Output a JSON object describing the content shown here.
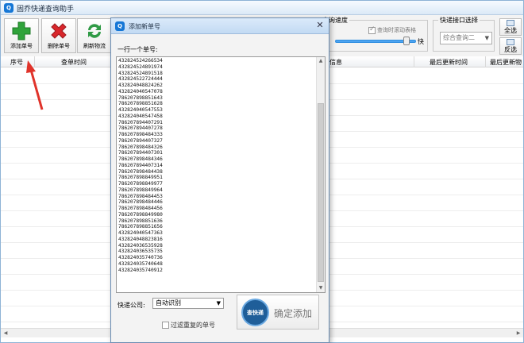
{
  "main_window": {
    "title": "固乔快递查询助手"
  },
  "toolbar": {
    "add_label": "添加单号",
    "delete_label": "删除单号",
    "refresh_label": "刷新物流"
  },
  "speed_group": {
    "title": "查询速度",
    "scroll_checkbox_label": "查询时滚动表格",
    "scroll_checked": true,
    "fast_label": "快",
    "speed_level": 0.92
  },
  "api_group": {
    "title": "快递接口选择",
    "selected": "综合查询二"
  },
  "side_buttons": {
    "select_all": "全选",
    "invert": "反选"
  },
  "table": {
    "columns": [
      "序号",
      "查单时间",
      "物流信息",
      "最后更新时间",
      "最后更新物"
    ]
  },
  "dialog": {
    "title": "添加新单号",
    "prompt": "一行一个单号:",
    "tracking_numbers": [
      "432824524266534",
      "432824524891974",
      "432824524891518",
      "432824522724444",
      "432824048824262",
      "432824040547078",
      "786207898851643",
      "786207898851628",
      "432824040547553",
      "432824040547458",
      "786207894407291",
      "786207894407278",
      "786207898484333",
      "786207894407327",
      "786207898484326",
      "786207894407301",
      "786207898484346",
      "786207894407314",
      "786207898484438",
      "786207898849951",
      "786207898849977",
      "786207898849964",
      "786207898484453",
      "786207898484446",
      "786207898484456",
      "786207898849980",
      "786207898851636",
      "786207898851656",
      "432824040547363",
      "432824048823816",
      "432824036535928",
      "432824036535735",
      "432824035740736",
      "432824035740648",
      "432824035740912"
    ],
    "company_label": "快递公司:",
    "company_selected": "自动识别",
    "dedupe_label": "过滤重复的单号",
    "dedupe_checked": false,
    "confirm_logo_text": "查快递",
    "confirm_label": "确定添加"
  },
  "colors": {
    "annotation_arrow": "#e0332a",
    "title_accent": "#1677d6",
    "add_icon": "#2fa33a",
    "delete_icon": "#d9262b",
    "refresh_icon": "#2f9a45"
  }
}
